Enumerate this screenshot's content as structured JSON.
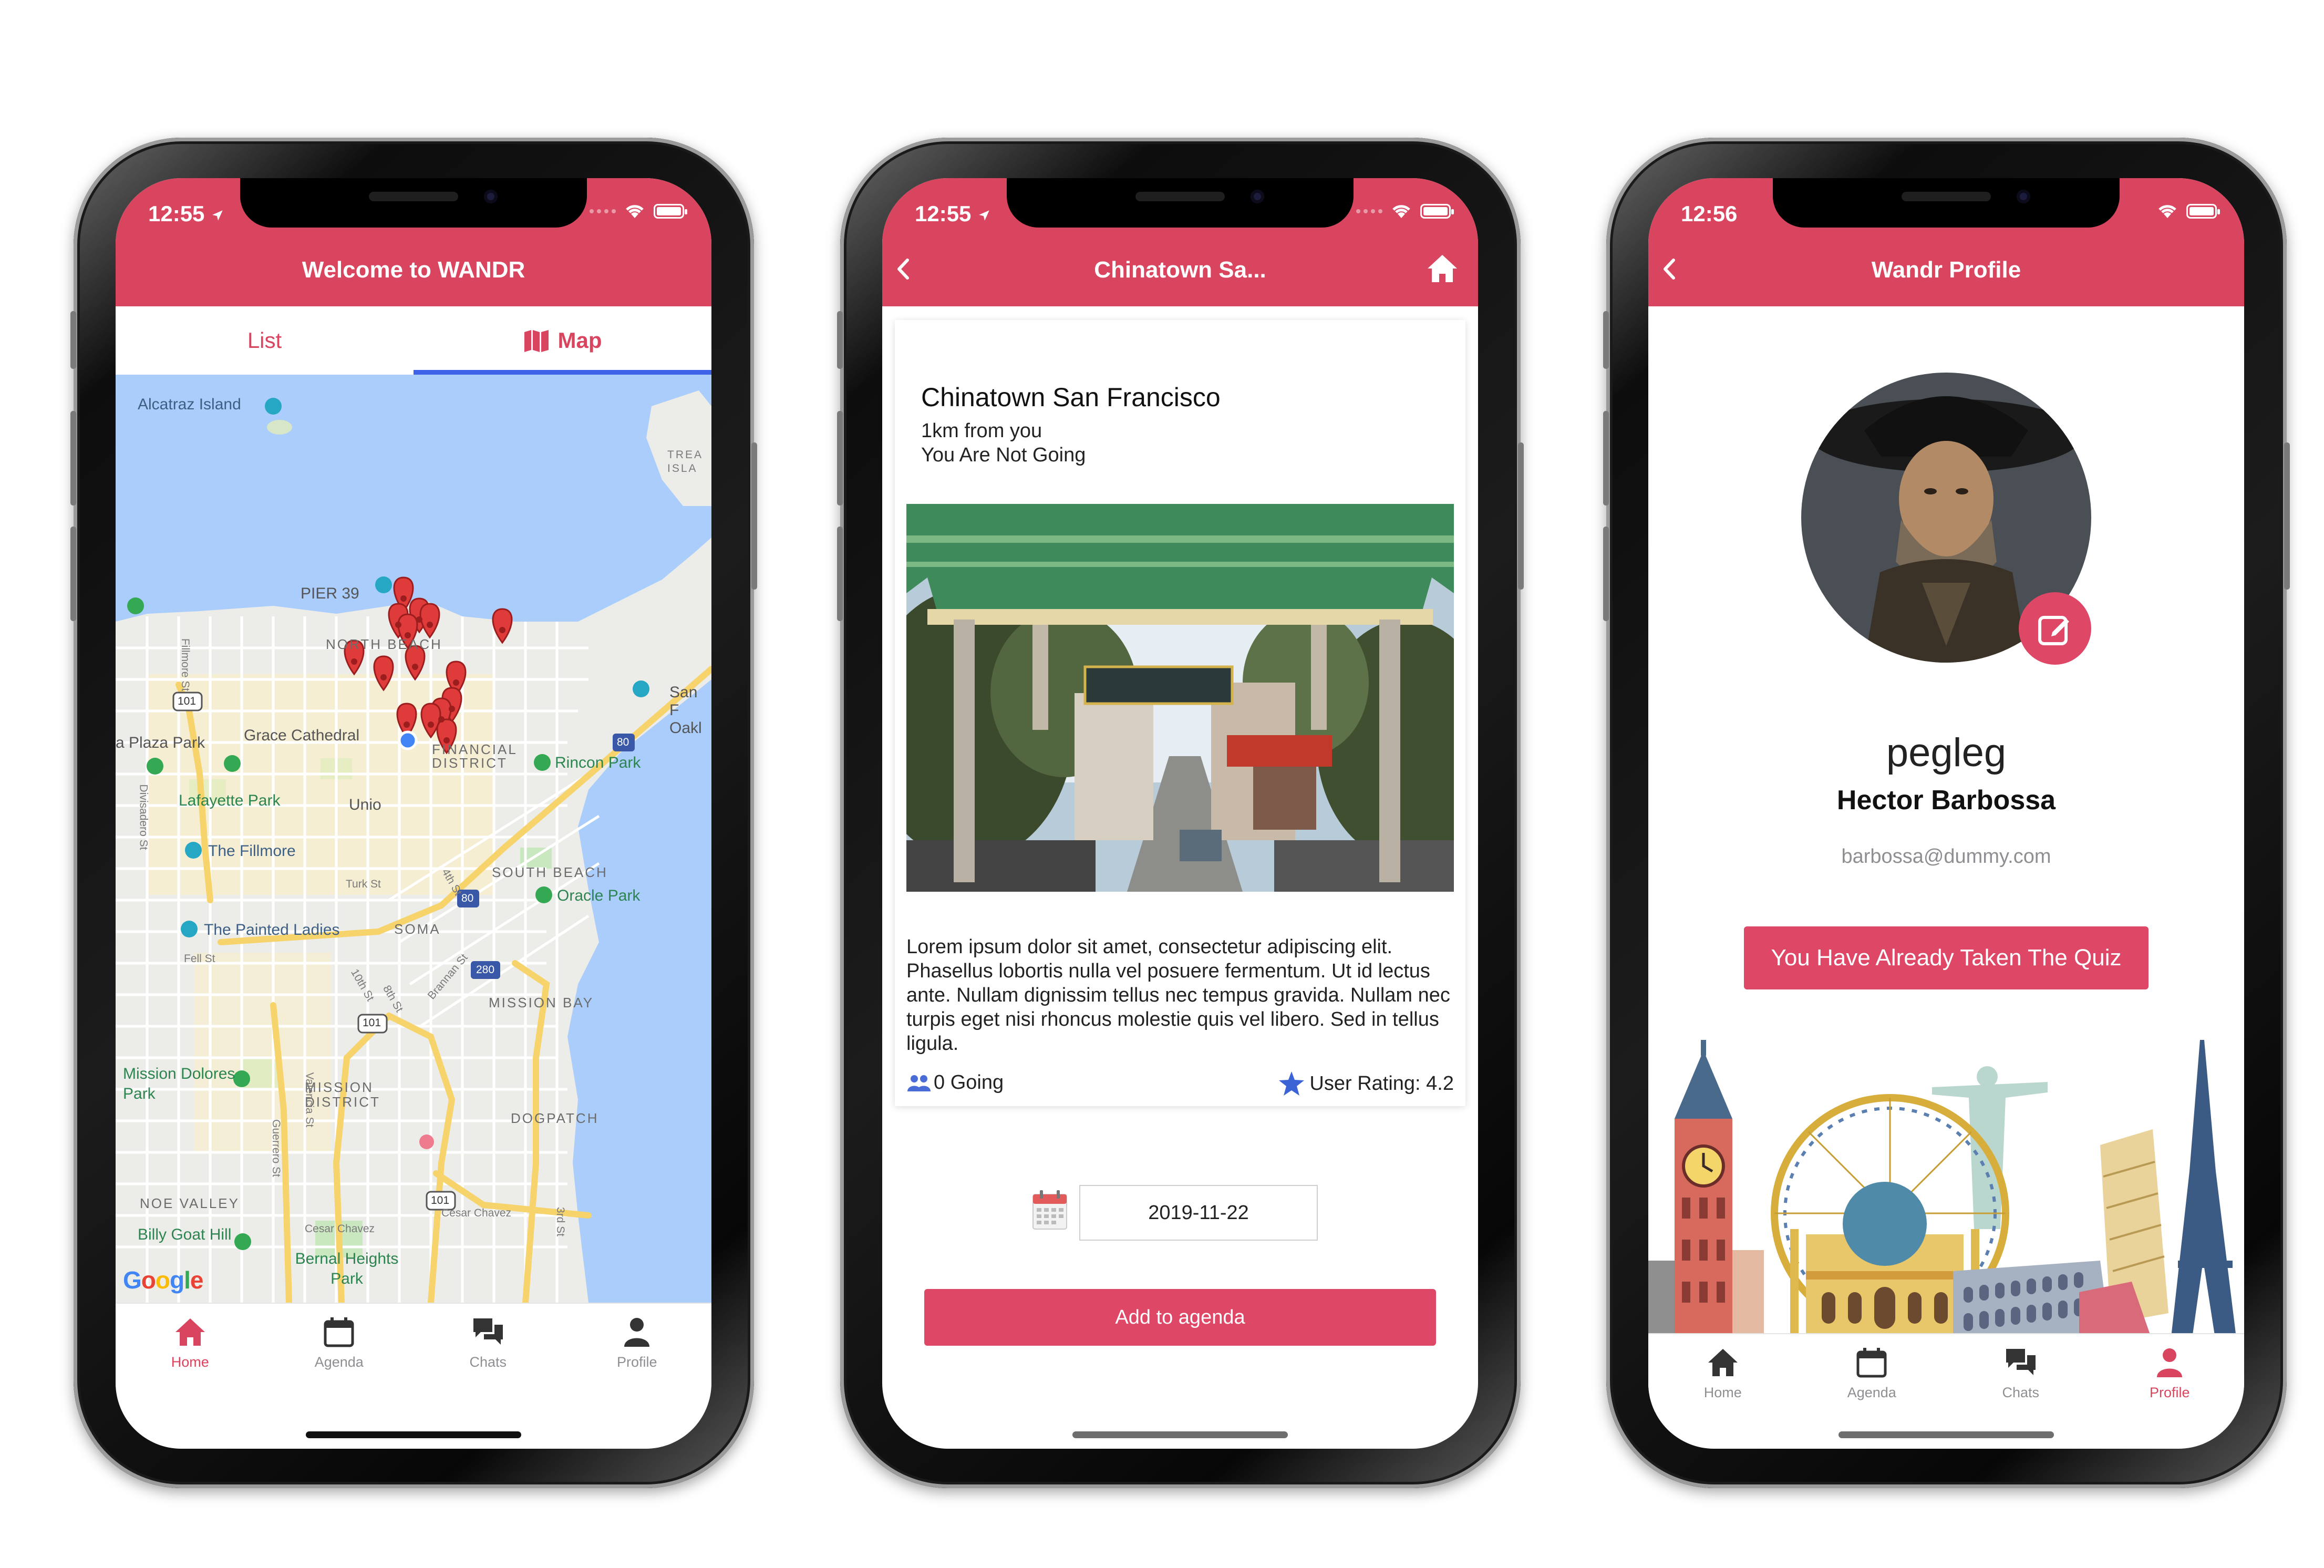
{
  "status_bar": {
    "time_a": "12:55",
    "time_b": "12:55",
    "time_c": "12:56"
  },
  "tabs": [
    {
      "label": "Home",
      "icon": "home-icon"
    },
    {
      "label": "Agenda",
      "icon": "calendar-icon"
    },
    {
      "label": "Chats",
      "icon": "chats-icon"
    },
    {
      "label": "Profile",
      "icon": "user-icon"
    }
  ],
  "colors": {
    "brand": "#d9455f",
    "button": "#df4766",
    "accent": "#3f63e8",
    "inactive": "#8e8e93"
  },
  "map_screen": {
    "title": "Welcome to WANDR",
    "segments": {
      "list": "List",
      "map": "Map"
    },
    "places": {
      "alcatraz": "Alcatraz Island",
      "treasure": "TREA ISLA",
      "pier39": "PIER 39",
      "north_beach": "NORTH BEACH",
      "sf_oakland": "San F Oakl",
      "plaza_park": "a Plaza Park",
      "grace": "Grace Cathedral",
      "financial": "FINANCIAL DISTRICT",
      "rincon": "Rincon Park",
      "lafayette": "Lafayette Park",
      "union": "Unio",
      "fillmore": "The Fillmore",
      "south_beach": "SOUTH BEACH",
      "oracle": "Oracle Park",
      "painted": "The Painted Ladies",
      "soma": "SOMA",
      "mission_bay": "MISSION BAY",
      "mission_dolores": "Mission Dolores Park",
      "mission_district": "MISSION DISTRICT",
      "dogpatch": "DOGPATCH",
      "noe": "NOE VALLEY",
      "billy": "Billy Goat Hill",
      "bernal": "Bernal Heights Park"
    },
    "streets": {
      "fillmore_st": "Fillmore St",
      "divisadero": "Divisadero St",
      "turk": "Turk St",
      "fell": "Fell St",
      "valencia": "Valencia St",
      "guerrero": "Guerrero St",
      "brannan": "Brannan St",
      "tenth": "10th St",
      "eighth": "8th St",
      "fourth": "4th St",
      "cesar": "Cesar Chavez",
      "third": "3rd St"
    },
    "shields": {
      "us101": "101",
      "i80": "80",
      "i280": "280"
    },
    "google": "Google"
  },
  "detail_screen": {
    "title": "Chinatown Sa...",
    "event_name": "Chinatown San Francisco",
    "distance": "1km from you",
    "attendance_status": "You Are Not Going",
    "description": "Lorem ipsum dolor sit amet, consectetur adipiscing elit. Phasellus lobortis nulla vel posuere fermentum. Ut id lectus ante. Nullam dignissim tellus nec tempus gravida. Nullam nec turpis eget nisi rhoncus molestie quis vel libero. Sed in tellus ligula.",
    "going": "0 Going",
    "rating": "User Rating: 4.2",
    "date": "2019-11-22",
    "add_button": "Add to agenda"
  },
  "profile_screen": {
    "title": "Wandr Profile",
    "username": "pegleg",
    "full_name": "Hector Barbossa",
    "email": "barbossa@dummy.com",
    "quiz_button": "You Have Already Taken The Quiz"
  }
}
